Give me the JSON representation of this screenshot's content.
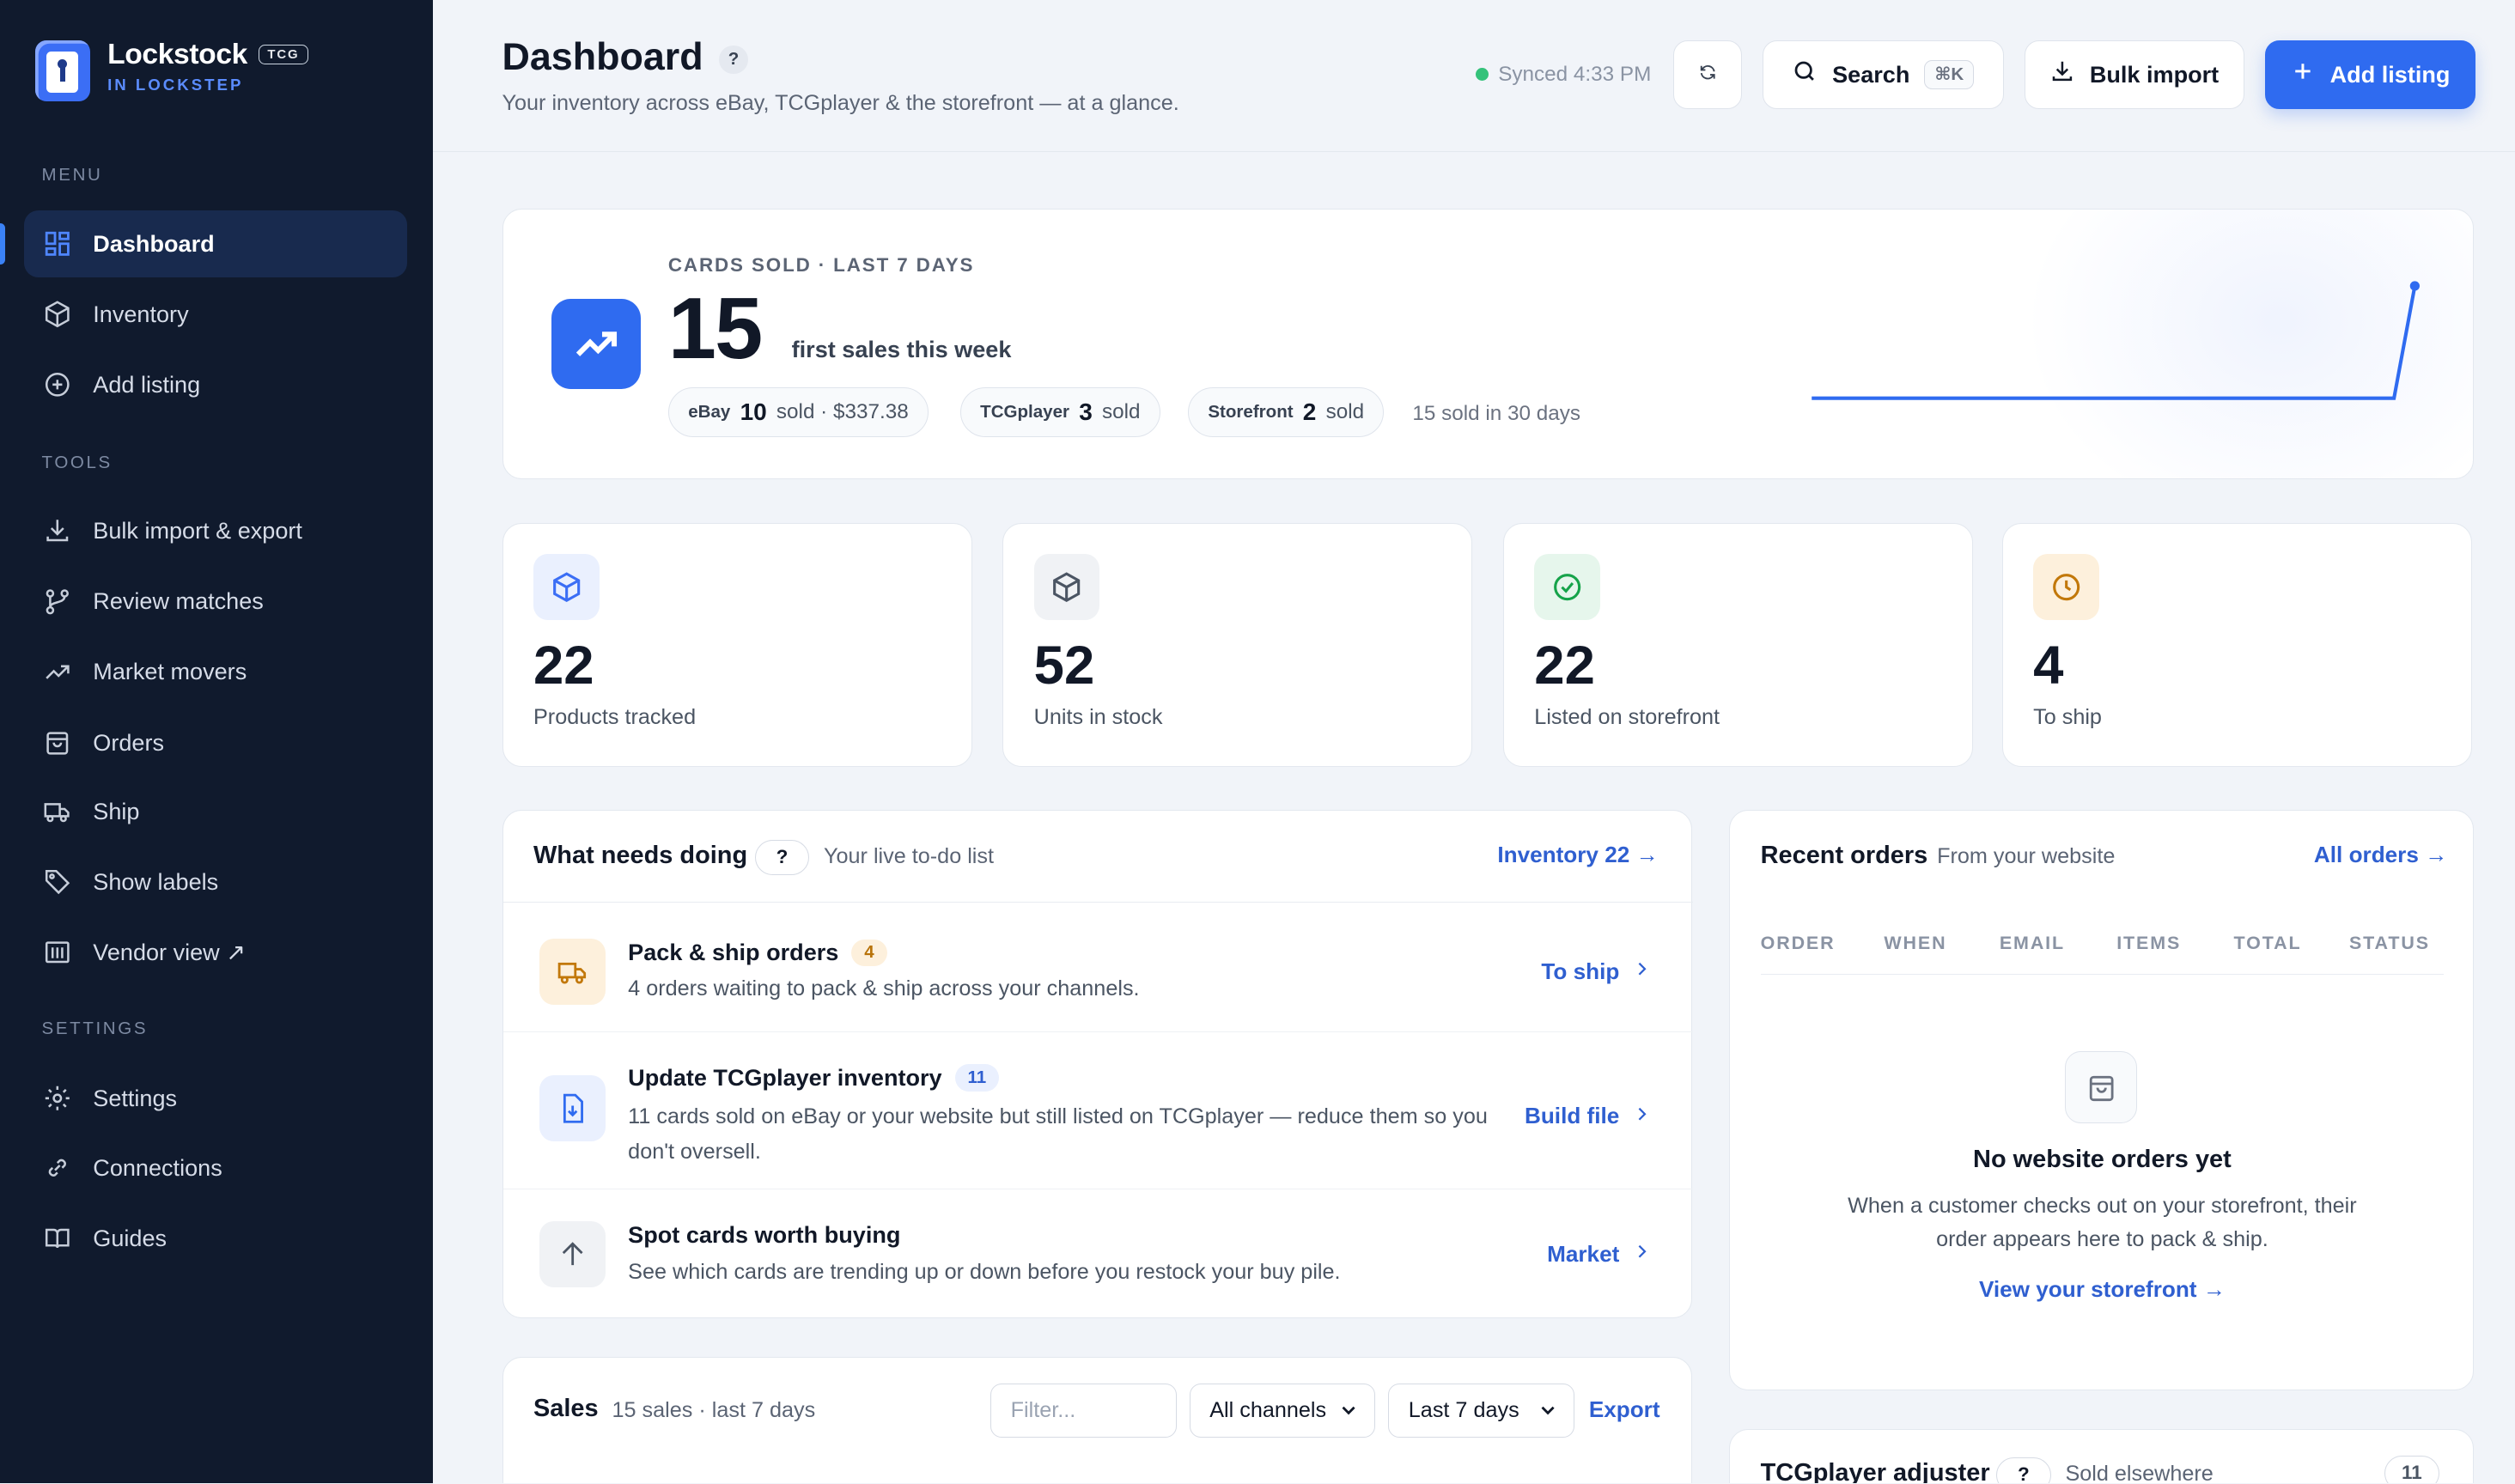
{
  "brand": {
    "name": "Lockstock",
    "badge": "TCG",
    "tagline": "IN LOCKSTEP"
  },
  "sidebar": {
    "menu_label": "MENU",
    "tools_label": "TOOLS",
    "settings_label": "SETTINGS",
    "menu_items": [
      {
        "label": "Dashboard",
        "icon": "grid-icon",
        "active": true
      },
      {
        "label": "Inventory",
        "icon": "box-icon"
      },
      {
        "label": "Add listing",
        "icon": "plus-circle-icon"
      }
    ],
    "tool_items": [
      {
        "label": "Bulk import & export",
        "icon": "download-icon"
      },
      {
        "label": "Review matches",
        "icon": "git-merge-icon"
      },
      {
        "label": "Market movers",
        "icon": "trending-icon"
      },
      {
        "label": "Orders",
        "icon": "bag-icon"
      },
      {
        "label": "Ship",
        "icon": "truck-icon"
      },
      {
        "label": "Show labels",
        "icon": "tag-icon"
      },
      {
        "label": "Vendor view ↗",
        "icon": "columns-icon"
      }
    ],
    "settings_items": [
      {
        "label": "Settings",
        "icon": "gear-icon"
      },
      {
        "label": "Connections",
        "icon": "link-icon"
      },
      {
        "label": "Guides",
        "icon": "book-icon"
      }
    ]
  },
  "header": {
    "title": "Dashboard",
    "help": "?",
    "subtitle": "Your inventory across eBay, TCGplayer & the storefront — at a glance.",
    "sync_status": "Synced 4:33 PM",
    "search_label": "Search",
    "search_shortcut": "⌘K",
    "bulk_import_label": "Bulk import",
    "add_listing_label": "Add listing"
  },
  "hero": {
    "label": "CARDS SOLD · LAST 7 DAYS",
    "value": "15",
    "value_caption": "first sales this week",
    "channels": [
      {
        "name": "eBay",
        "count": "10",
        "suffix": "sold · $337.38"
      },
      {
        "name": "TCGplayer",
        "count": "3",
        "suffix": "sold"
      },
      {
        "name": "Storefront",
        "count": "2",
        "suffix": "sold"
      }
    ],
    "thirty_day": "15 sold in 30 days",
    "sparkline": [
      0,
      0,
      0,
      0,
      0,
      0,
      0,
      0,
      0,
      0,
      0,
      0,
      0,
      0,
      0,
      0,
      0,
      0,
      0,
      0,
      0,
      0,
      0,
      0,
      0,
      0,
      0,
      0,
      0,
      15
    ]
  },
  "stats": [
    {
      "value": "22",
      "label": "Products tracked",
      "icon": "box-icon",
      "color": "#3b6ef5",
      "bg": "#eaf0fe"
    },
    {
      "value": "52",
      "label": "Units in stock",
      "icon": "box-icon",
      "color": "#4b5563",
      "bg": "#f0f2f5"
    },
    {
      "value": "22",
      "label": "Listed on storefront",
      "icon": "check-circle-icon",
      "color": "#16a34a",
      "bg": "#e6f6ec"
    },
    {
      "value": "4",
      "label": "To ship",
      "icon": "clock-icon",
      "color": "#c2780a",
      "bg": "#fdf0dc"
    }
  ],
  "todo": {
    "title": "What needs doing",
    "help": "?",
    "subtitle": "Your live to-do list",
    "inventory_link": "Inventory 22 →",
    "rows": [
      {
        "title": "Pack & ship orders",
        "badge": "4",
        "desc": "4 orders waiting to pack & ship across your channels.",
        "action": "To ship",
        "icon": "truck-icon"
      },
      {
        "title": "Update TCGplayer inventory",
        "badge": "11",
        "desc": "11 cards sold on eBay or your website but still listed on TCGplayer — reduce them so you don't oversell.",
        "action": "Build file",
        "icon": "file-download-icon"
      },
      {
        "title": "Spot cards worth buying",
        "badge": "",
        "desc": "See which cards are trending up or down before you restock your buy pile.",
        "action": "Market",
        "icon": "arrow-up-icon"
      }
    ]
  },
  "orders": {
    "title": "Recent orders",
    "subtitle": "From your website",
    "all_link": "All orders →",
    "columns": [
      "ORDER",
      "WHEN",
      "EMAIL",
      "ITEMS",
      "TOTAL",
      "STATUS"
    ],
    "empty_title": "No website orders yet",
    "empty_desc": "When a customer checks out on your storefront, their order appears here to pack & ship.",
    "empty_link": "View your storefront →"
  },
  "sales": {
    "title": "Sales",
    "subtitle": "15 sales · last 7 days",
    "filter_placeholder": "Filter...",
    "channel_select": "All channels",
    "range_select": "Last 7 days",
    "export_label": "Export"
  },
  "adjuster": {
    "title": "TCGplayer adjuster",
    "help": "?",
    "subtitle": "Sold elsewhere",
    "count": "11"
  }
}
